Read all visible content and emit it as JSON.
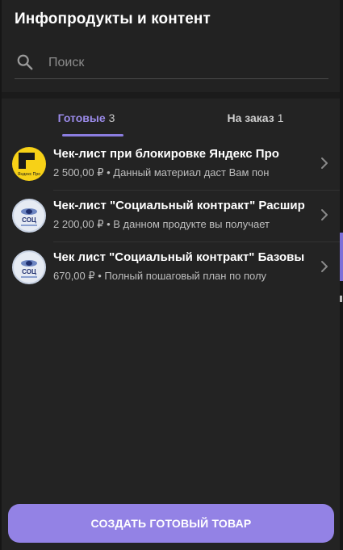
{
  "header": {
    "title": "Инфопродукты и контент"
  },
  "search": {
    "placeholder": "Поиск",
    "icon": "search-icon"
  },
  "tabs": [
    {
      "label": "Готовые",
      "count": "3",
      "active": true
    },
    {
      "label": "На заказ",
      "count": "1",
      "active": false
    }
  ],
  "items": [
    {
      "title": "Чек-лист при блокировке Яндекс Про",
      "subtitle": "2 500,00 ₽ • Данный материал даст Вам пон",
      "avatar_icon": "yandex-pro-logo",
      "avatar_text": "Яндекс Про"
    },
    {
      "title": "Чек-лист \"Социальный контракт\" Расшир",
      "subtitle": "2 200,00 ₽ • В данном продукте вы получает",
      "avatar_icon": "socz-logo",
      "avatar_text": "СОЦ"
    },
    {
      "title": "Чек лист \"Социальный контракт\" Базовы",
      "subtitle": "670,00 ₽ • Полный пошаговый план по полу",
      "avatar_icon": "socz-logo",
      "avatar_text": "СОЦ"
    }
  ],
  "cta": {
    "label": "СОЗДАТЬ ГОТОВЫЙ ТОВАР"
  },
  "colors": {
    "accent": "#9382e5",
    "tab_active": "#9b8bea",
    "background": "#1b1b1b",
    "panel": "#232323",
    "yandex_yellow": "#f7d117"
  }
}
